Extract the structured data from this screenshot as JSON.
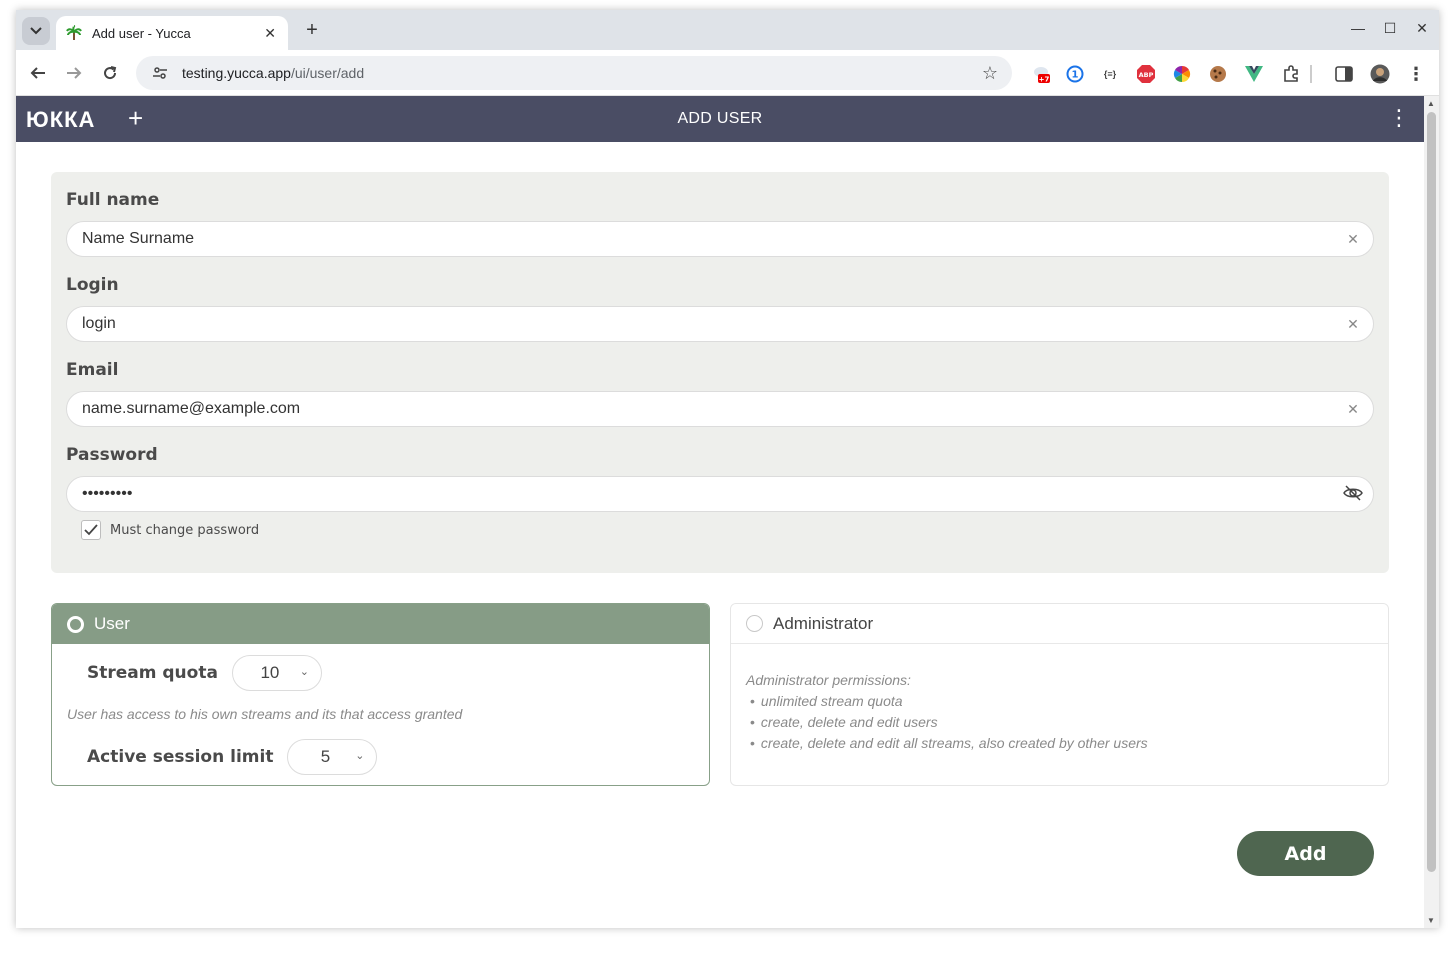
{
  "browser": {
    "tab_title": "Add user - Yucca",
    "url_host": "testing.yucca.app",
    "url_path": "/ui/user/add",
    "extension_badge": "+7",
    "ext_braces": "{≡}",
    "ext_abp": "ABP",
    "ext_onepassword": "1",
    "ext_vue": "V"
  },
  "appbar": {
    "logo": "ЮККА",
    "title": "ADD USER"
  },
  "form": {
    "full_name": {
      "label": "Full name",
      "value": "Name Surname"
    },
    "login": {
      "label": "Login",
      "value": "login"
    },
    "email": {
      "label": "Email",
      "value": "name.surname@example.com"
    },
    "password": {
      "label": "Password",
      "value": "•••••••••"
    },
    "must_change_password": {
      "label": "Must change password",
      "checked": true
    }
  },
  "roles": {
    "user": {
      "label": "User",
      "selected": true,
      "stream_quota_label": "Stream quota",
      "stream_quota_value": "10",
      "note": "User has access to his own streams and its that access granted",
      "session_limit_label": "Active session limit",
      "session_limit_value": "5"
    },
    "admin": {
      "label": "Administrator",
      "selected": false,
      "permissions_title": "Administrator permissions:",
      "permissions": [
        "unlimited stream quota",
        "create, delete and edit users",
        "create, delete and edit all streams, also created by other users"
      ]
    }
  },
  "actions": {
    "add_label": "Add"
  },
  "colors": {
    "appbar": "#4a4d64",
    "user_role_header": "#869c86",
    "add_button": "#4f6650",
    "form_background": "#eeefec"
  }
}
